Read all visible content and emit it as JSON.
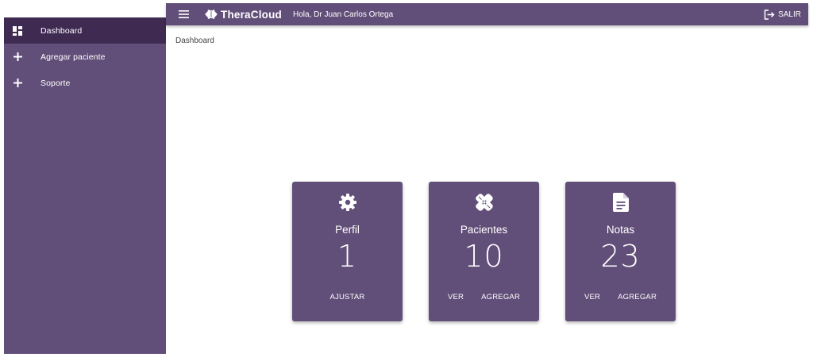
{
  "sidebar": {
    "items": [
      {
        "label": "Dashboard",
        "icon": "dashboard-icon",
        "active": true
      },
      {
        "label": "Agregar paciente",
        "icon": "plus-icon",
        "active": false
      },
      {
        "label": "Soporte",
        "icon": "plus-icon",
        "active": false
      }
    ]
  },
  "header": {
    "brand": "TheraCloud",
    "greeting": "Hola, Dr Juan Carlos Ortega",
    "logout_label": "SALIR"
  },
  "breadcrumb": "Dashboard",
  "cards": [
    {
      "title": "Perfil",
      "count": "1",
      "icon": "gear-icon",
      "actions": [
        "AJUSTAR"
      ]
    },
    {
      "title": "Pacientes",
      "count": "10",
      "icon": "bandage-icon",
      "actions": [
        "VER",
        "AGREGAR"
      ]
    },
    {
      "title": "Notas",
      "count": "23",
      "icon": "document-icon",
      "actions": [
        "VER",
        "AGREGAR"
      ]
    }
  ],
  "colors": {
    "primary": "#624f79",
    "sidebar_active": "#3f2a52",
    "text_light": "#ffffff"
  }
}
